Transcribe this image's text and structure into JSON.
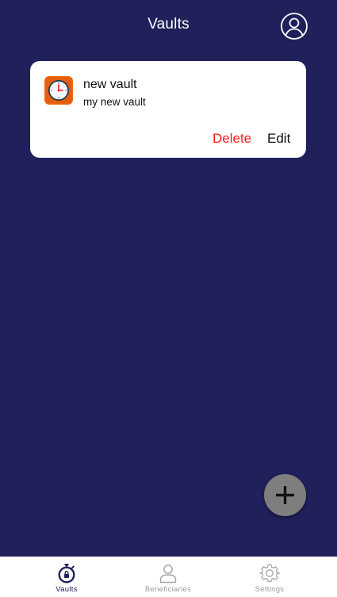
{
  "header": {
    "title": "Vaults",
    "profile_icon": "user-circle-icon"
  },
  "vaults": [
    {
      "name": "new vault",
      "description": "my new vault",
      "icon": "clock-icon",
      "delete_label": "Delete",
      "edit_label": "Edit"
    }
  ],
  "fab": {
    "icon": "plus-icon"
  },
  "tabbar": {
    "tabs": [
      {
        "label": "Vaults",
        "icon": "stopwatch-lock-icon",
        "active": true
      },
      {
        "label": "Beneficiaries",
        "icon": "person-icon",
        "active": false
      },
      {
        "label": "Settings",
        "icon": "gear-icon",
        "active": false
      }
    ]
  },
  "colors": {
    "background": "#20215b",
    "card": "#ffffff",
    "delete": "#f21b1b",
    "fab": "#7e7e7e",
    "tab_active": "#20215b",
    "tab_inactive": "#9a9a9a",
    "vault_icon": "#f06a12"
  }
}
